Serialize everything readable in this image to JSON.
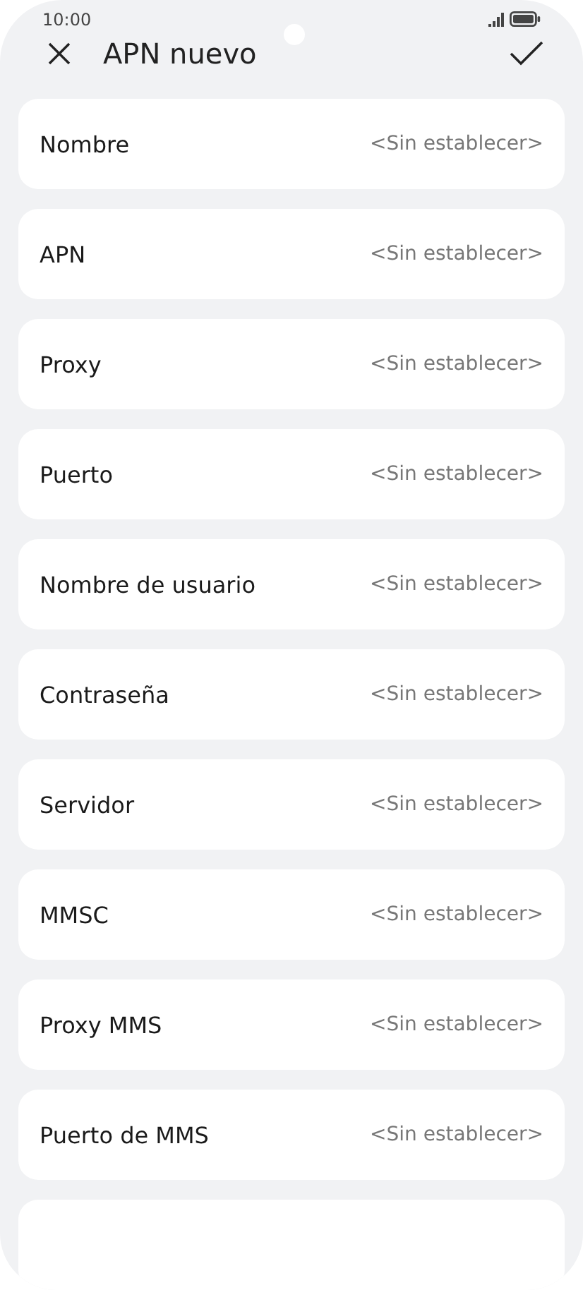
{
  "status_bar": {
    "time": "10:00"
  },
  "header": {
    "title": "APN nuevo"
  },
  "fields": [
    {
      "label": "Nombre",
      "value": "<Sin establecer>"
    },
    {
      "label": "APN",
      "value": "<Sin establecer>"
    },
    {
      "label": "Proxy",
      "value": "<Sin establecer>"
    },
    {
      "label": "Puerto",
      "value": "<Sin establecer>"
    },
    {
      "label": "Nombre de usuario",
      "value": "<Sin establecer>"
    },
    {
      "label": "Contraseña",
      "value": "<Sin establecer>"
    },
    {
      "label": "Servidor",
      "value": "<Sin establecer>"
    },
    {
      "label": "MMSC",
      "value": "<Sin establecer>"
    },
    {
      "label": "Proxy MMS",
      "value": "<Sin establecer>"
    },
    {
      "label": "Puerto de MMS",
      "value": "<Sin establecer>"
    }
  ]
}
